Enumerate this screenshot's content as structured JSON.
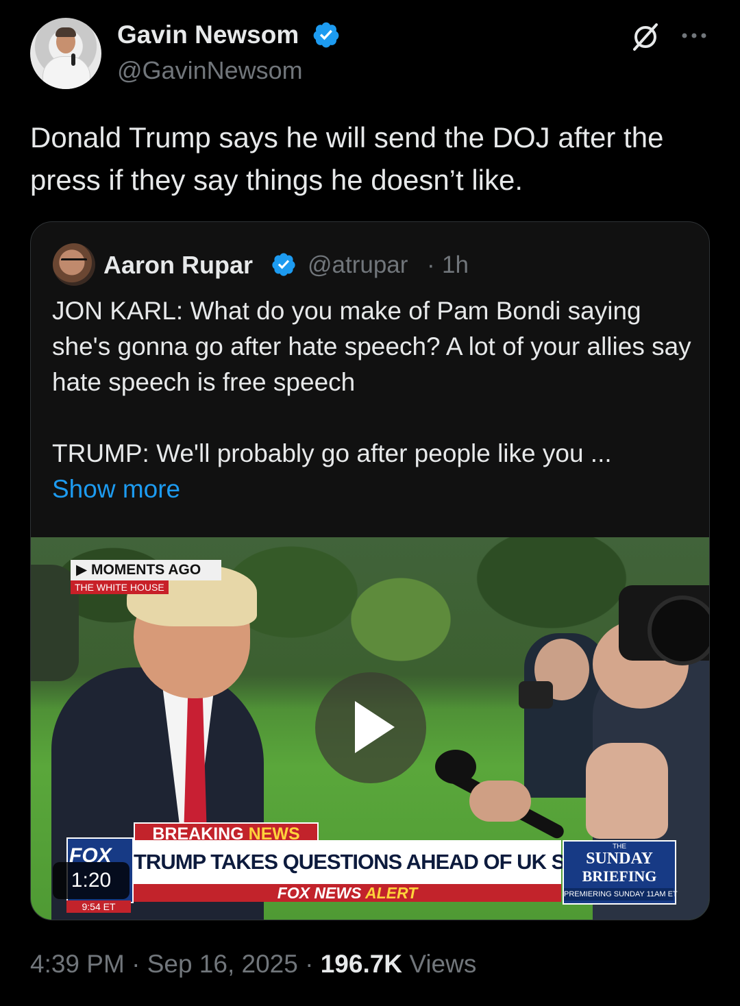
{
  "author": {
    "name": "Gavin Newsom",
    "handle": "@GavinNewsom",
    "verified": true,
    "badge_color": "#1d9bf0"
  },
  "tweet": {
    "text": "Donald Trump says he will send the DOJ after the press if they say things he doesn’t like."
  },
  "icons": {
    "grok": "grok-icon",
    "more": "more-options-icon"
  },
  "quote": {
    "name": "Aaron Rupar",
    "handle": "@atrupar",
    "separator": "·",
    "time": "1h",
    "paragraph1": "JON KARL: What do you make of Pam Bondi saying she's gonna go after hate speech? A lot of your allies say hate speech is free speech",
    "paragraph2": "TRUMP: We'll probably go after people like you ...",
    "show_more": "Show more",
    "video": {
      "duration": "1:20",
      "moments_label": "MOMENTS AGO",
      "location_label": "THE WHITE HOUSE",
      "breaking_word1": "BREAKING",
      "breaking_word2": "NEWS",
      "headline": "TRUMP TAKES QUESTIONS AHEAD OF UK STATE VISIT",
      "alert_part1": "FOX NEWS",
      "alert_part2": "ALERT",
      "network_logo": "FOX",
      "clock": "9:54 ET",
      "promo_the": "THE",
      "promo_title1": "SUNDAY",
      "promo_title2": "BRIEFING",
      "promo_sub": "PREMIERING SUNDAY 11AM ET"
    }
  },
  "footer": {
    "time": "4:39 PM",
    "sep1": "·",
    "date": "Sep 16, 2025",
    "sep2": "·",
    "views_count": "196.7K",
    "views_label": "Views"
  },
  "colors": {
    "background": "#000000",
    "text_primary": "#e7e9ea",
    "text_secondary": "#71767b",
    "link": "#1d9bf0",
    "card_border": "#2f3336"
  }
}
